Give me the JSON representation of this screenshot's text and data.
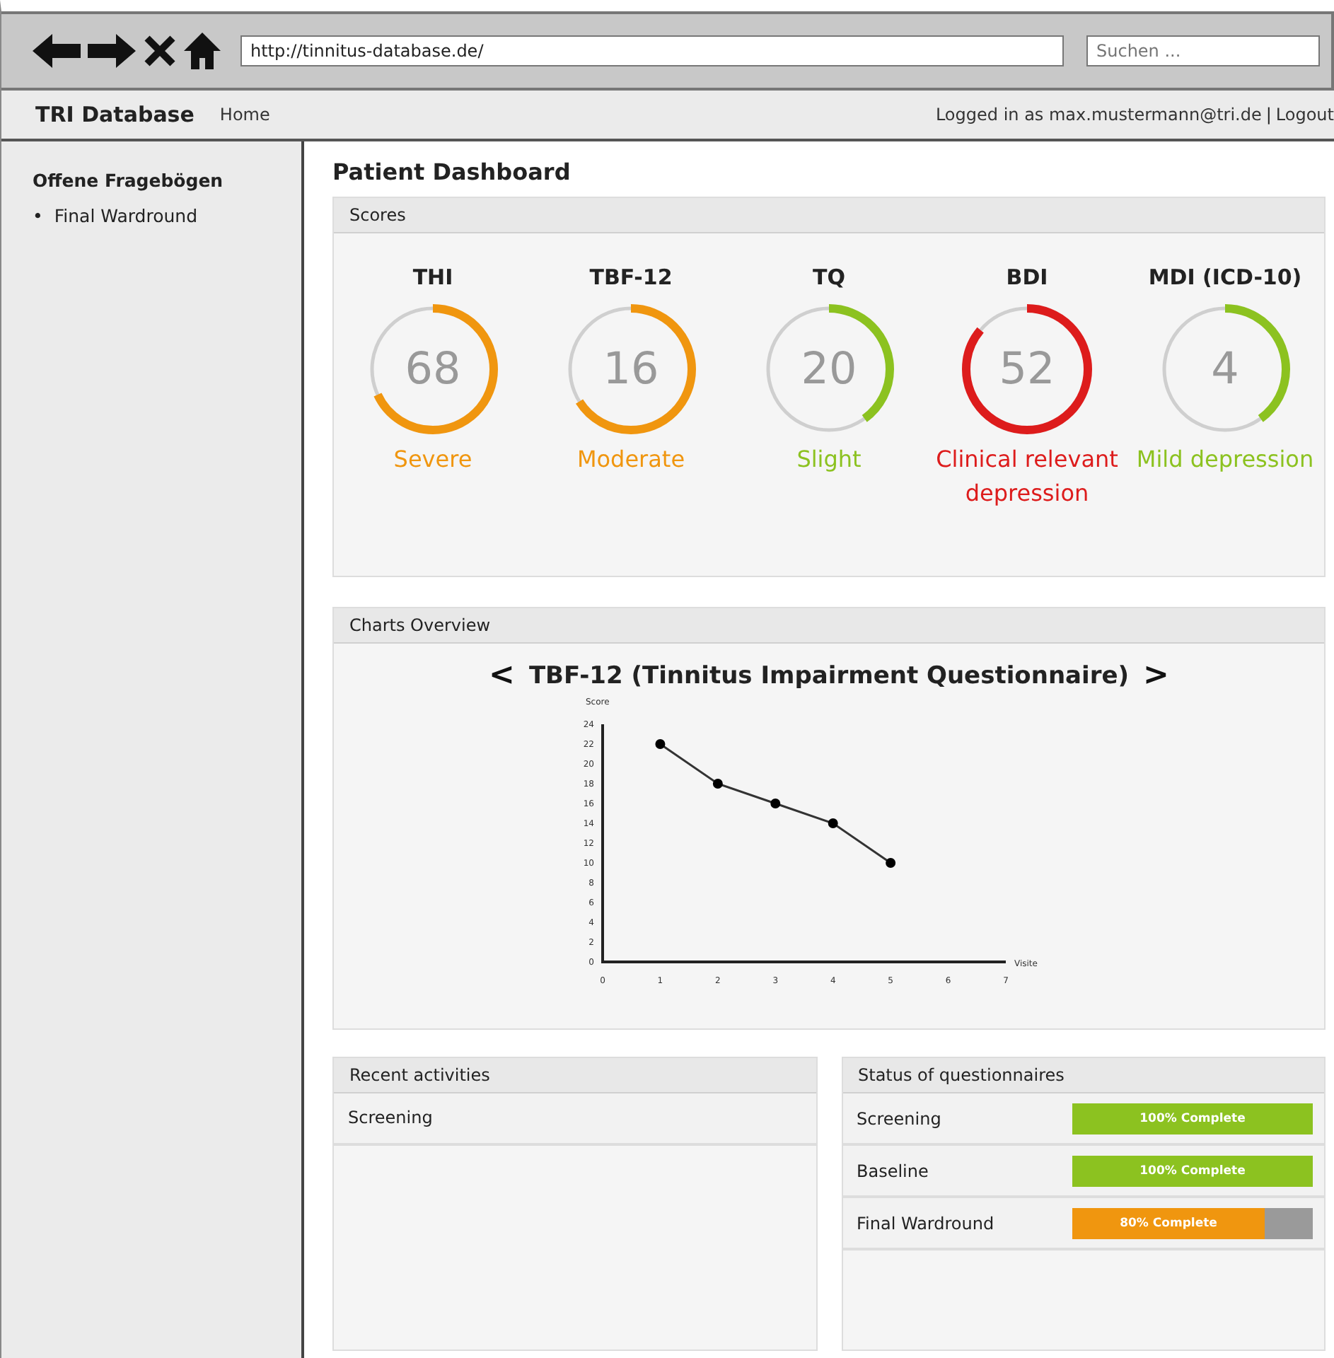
{
  "browser": {
    "url": "http://tinnitus-database.de/",
    "search_placeholder": "Suchen ..."
  },
  "nav": {
    "brand": "TRI Database",
    "links": [
      "Home"
    ],
    "user_text": "Logged in as max.mustermann@tri.de",
    "separator": "|",
    "logout": "Logout"
  },
  "sidebar": {
    "heading": "Offene Fragebögen",
    "items": [
      {
        "bullet": "•",
        "label": "Final Wardround"
      }
    ]
  },
  "page_title": "Patient Dashboard",
  "scores": {
    "title": "Scores",
    "items": [
      {
        "name": "THI",
        "value": "68",
        "rating": "Severe",
        "level": 0.68,
        "color": "#f0960f"
      },
      {
        "name": "TBF-12",
        "value": "16",
        "rating": "Moderate",
        "level": 0.66,
        "color": "#f0960f"
      },
      {
        "name": "TQ",
        "value": "20",
        "rating": "Slight",
        "level": 0.4,
        "color": "#8cc220"
      },
      {
        "name": "BDI",
        "value": "52",
        "rating": "Clinical relevant depression",
        "level": 0.86,
        "color": "#dd1c1c"
      },
      {
        "name": "MDI (ICD-10)",
        "value": "4",
        "rating": "Mild depression",
        "level": 0.4,
        "color": "#8cc220"
      }
    ]
  },
  "charts": {
    "title": "Charts Overview",
    "prev": "<",
    "next": ">",
    "chart_data": {
      "type": "line",
      "title": "TBF-12 (Tinnitus Impairment Questionnaire)",
      "xlabel": "Visite",
      "ylabel": "Score",
      "x": [
        1,
        2,
        3,
        4,
        5
      ],
      "values": [
        22,
        18,
        16,
        14,
        10
      ],
      "marker": "o",
      "xlim": [
        0,
        7
      ],
      "ylim": [
        0,
        24
      ],
      "xticks": [
        0,
        1,
        2,
        3,
        4,
        5,
        6,
        7
      ],
      "yticks": [
        0,
        2,
        4,
        6,
        8,
        10,
        12,
        14,
        16,
        18,
        20,
        22,
        24
      ]
    }
  },
  "recent": {
    "title": "Recent activities",
    "rows": [
      "Screening"
    ]
  },
  "status": {
    "title": "Status of questionnaires",
    "rows": [
      {
        "name": "Screening",
        "label": "100% Complete",
        "level": 1,
        "color": "#8cc220"
      },
      {
        "name": "Baseline",
        "label": "100% Complete",
        "level": 1,
        "color": "#8cc220"
      },
      {
        "name": "Final Wardround",
        "label": "80% Complete",
        "level": 0.8,
        "color": "#f0960f"
      }
    ]
  }
}
